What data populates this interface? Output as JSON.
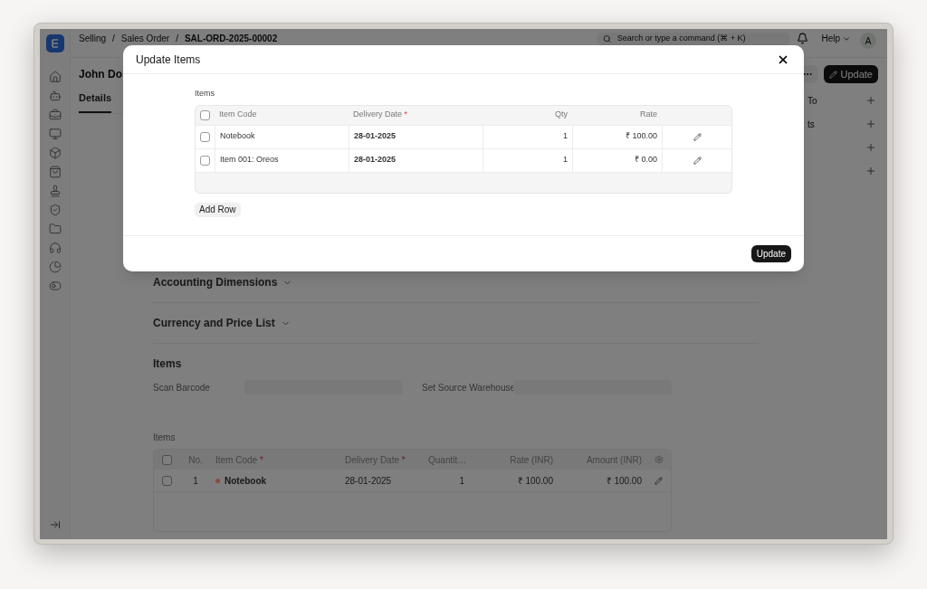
{
  "breadcrumbs": [
    "Selling",
    "Sales Order",
    "SAL-ORD-2025-00002"
  ],
  "breadcrumb_separators": [
    "/",
    "/"
  ],
  "search": {
    "placeholder": "Search or type a command (⌘ + K)"
  },
  "help": "Help",
  "avatar": "A",
  "page": {
    "title": "John Do",
    "primary_action": "Update"
  },
  "tabs": [
    {
      "label": "Details",
      "selected": true
    }
  ],
  "side_links": [
    {
      "label": "To"
    },
    {
      "label": "ts"
    }
  ],
  "sections": [
    {
      "title": "Accounting Dimensions"
    },
    {
      "title": "Currency and Price List"
    }
  ],
  "items_section": {
    "title": "Items",
    "fields": [
      {
        "label": "Scan Barcode"
      },
      {
        "label": "Set Source Warehouse"
      }
    ],
    "table": {
      "label": "Items",
      "all_checked": false,
      "columns": [
        {
          "label": "No."
        },
        {
          "label": "Item Code",
          "required_mark": "*"
        },
        {
          "label": "Delivery Date",
          "required_mark": "*"
        },
        {
          "label": "Quantit…"
        },
        {
          "label": "Rate (INR)"
        },
        {
          "label": "Amount (INR)"
        }
      ],
      "rows": [
        {
          "checked": false,
          "no": "1",
          "item_code": "Notebook",
          "color": "#8b4a3c",
          "delivery_date": "28-01-2025",
          "qty": "1",
          "rate": "₹ 100.00",
          "amount": "₹ 100.00"
        }
      ]
    }
  },
  "dialog": {
    "title": "Update Items",
    "table_label": "Items",
    "columns": [
      {
        "label": "Item Code"
      },
      {
        "label": "Delivery Date",
        "required_mark": "*"
      },
      {
        "label": "Qty"
      },
      {
        "label": "Rate"
      }
    ],
    "all_checked": false,
    "rows": [
      {
        "checked": false,
        "item_code": "Notebook",
        "delivery_date": "28-01-2025",
        "qty": "1",
        "rate": "₹ 100.00"
      },
      {
        "checked": false,
        "item_code": "Item 001: Oreos",
        "delivery_date": "28-01-2025",
        "qty": "1",
        "rate": "₹ 0.00"
      }
    ],
    "add_row": "Add Row",
    "submit": "Update"
  }
}
